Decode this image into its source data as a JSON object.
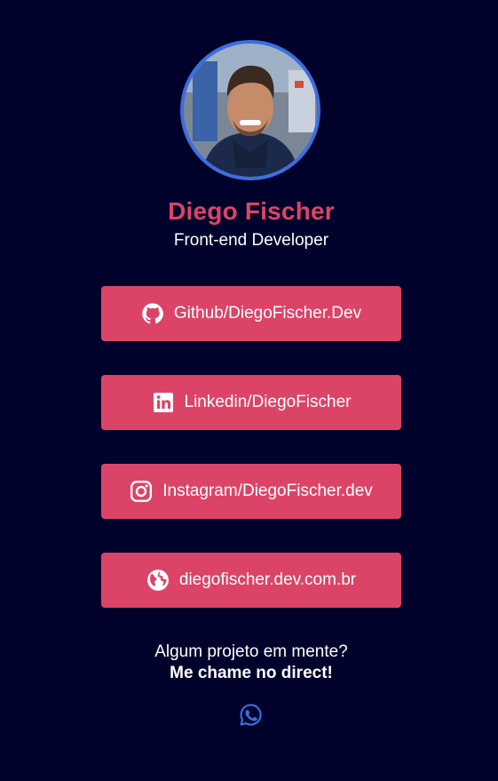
{
  "profile": {
    "name": "Diego Fischer",
    "role": "Front-end Developer"
  },
  "links": [
    {
      "label": "Github/DiegoFischer.Dev",
      "icon": "github-icon"
    },
    {
      "label": "Linkedin/DiegoFischer",
      "icon": "linkedin-icon"
    },
    {
      "label": "Instagram/DiegoFischer.dev",
      "icon": "instagram-icon"
    },
    {
      "label": "diegofischer.dev.com.br",
      "icon": "globe-icon"
    }
  ],
  "cta": {
    "line1": "Algum projeto em mente?",
    "line2": "Me chame no direct!"
  },
  "footer": {
    "icon": "whatsapp-icon"
  },
  "colors": {
    "background": "#00022b",
    "accent": "#dc4467",
    "avatar_ring": "#3a6fe0",
    "whatsapp": "#3a6fe0"
  }
}
